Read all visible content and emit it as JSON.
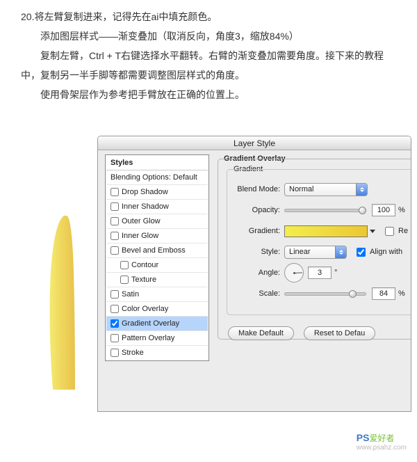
{
  "tutorial": {
    "line1": "20.将左臂复制进来，记得先在ai中填充颜色。",
    "line2": "添加图层样式——渐变叠加（取消反向，角度3，缩放84%）",
    "line3": "复制左臂，Ctrl + T右键选择水平翻转。右臂的渐变叠加需要角度。接下来的教程中，复制另一半手脚等都需要调整图层样式的角度。",
    "line4": "使用骨架层作为参考把手臂放在正确的位置上。"
  },
  "dialog": {
    "title": "Layer Style",
    "styles_header": "Styles",
    "blending_row": "Blending Options: Default",
    "items": [
      {
        "label": "Drop Shadow",
        "checked": false,
        "sub": false
      },
      {
        "label": "Inner Shadow",
        "checked": false,
        "sub": false
      },
      {
        "label": "Outer Glow",
        "checked": false,
        "sub": false
      },
      {
        "label": "Inner Glow",
        "checked": false,
        "sub": false
      },
      {
        "label": "Bevel and Emboss",
        "checked": false,
        "sub": false
      },
      {
        "label": "Contour",
        "checked": false,
        "sub": true
      },
      {
        "label": "Texture",
        "checked": false,
        "sub": true
      },
      {
        "label": "Satin",
        "checked": false,
        "sub": false
      },
      {
        "label": "Color Overlay",
        "checked": false,
        "sub": false
      },
      {
        "label": "Gradient Overlay",
        "checked": true,
        "sub": false,
        "selected": true
      },
      {
        "label": "Pattern Overlay",
        "checked": false,
        "sub": false
      },
      {
        "label": "Stroke",
        "checked": false,
        "sub": false
      }
    ],
    "group_outer": "Gradient Overlay",
    "group_inner": "Gradient",
    "labels": {
      "blend_mode": "Blend Mode:",
      "opacity": "Opacity:",
      "gradient": "Gradient:",
      "style": "Style:",
      "angle": "Angle:",
      "scale": "Scale:",
      "reverse": "Re",
      "align": "Align with"
    },
    "values": {
      "blend_mode": "Normal",
      "opacity": "100",
      "style_val": "Linear",
      "angle": "3",
      "angle_unit": "°",
      "scale": "84",
      "percent": "%"
    },
    "buttons": {
      "make_default": "Make Default",
      "reset": "Reset to Defau"
    }
  },
  "watermark": {
    "ps": "PS",
    "hz": "爱好者",
    "url": "www.psahz.com"
  }
}
